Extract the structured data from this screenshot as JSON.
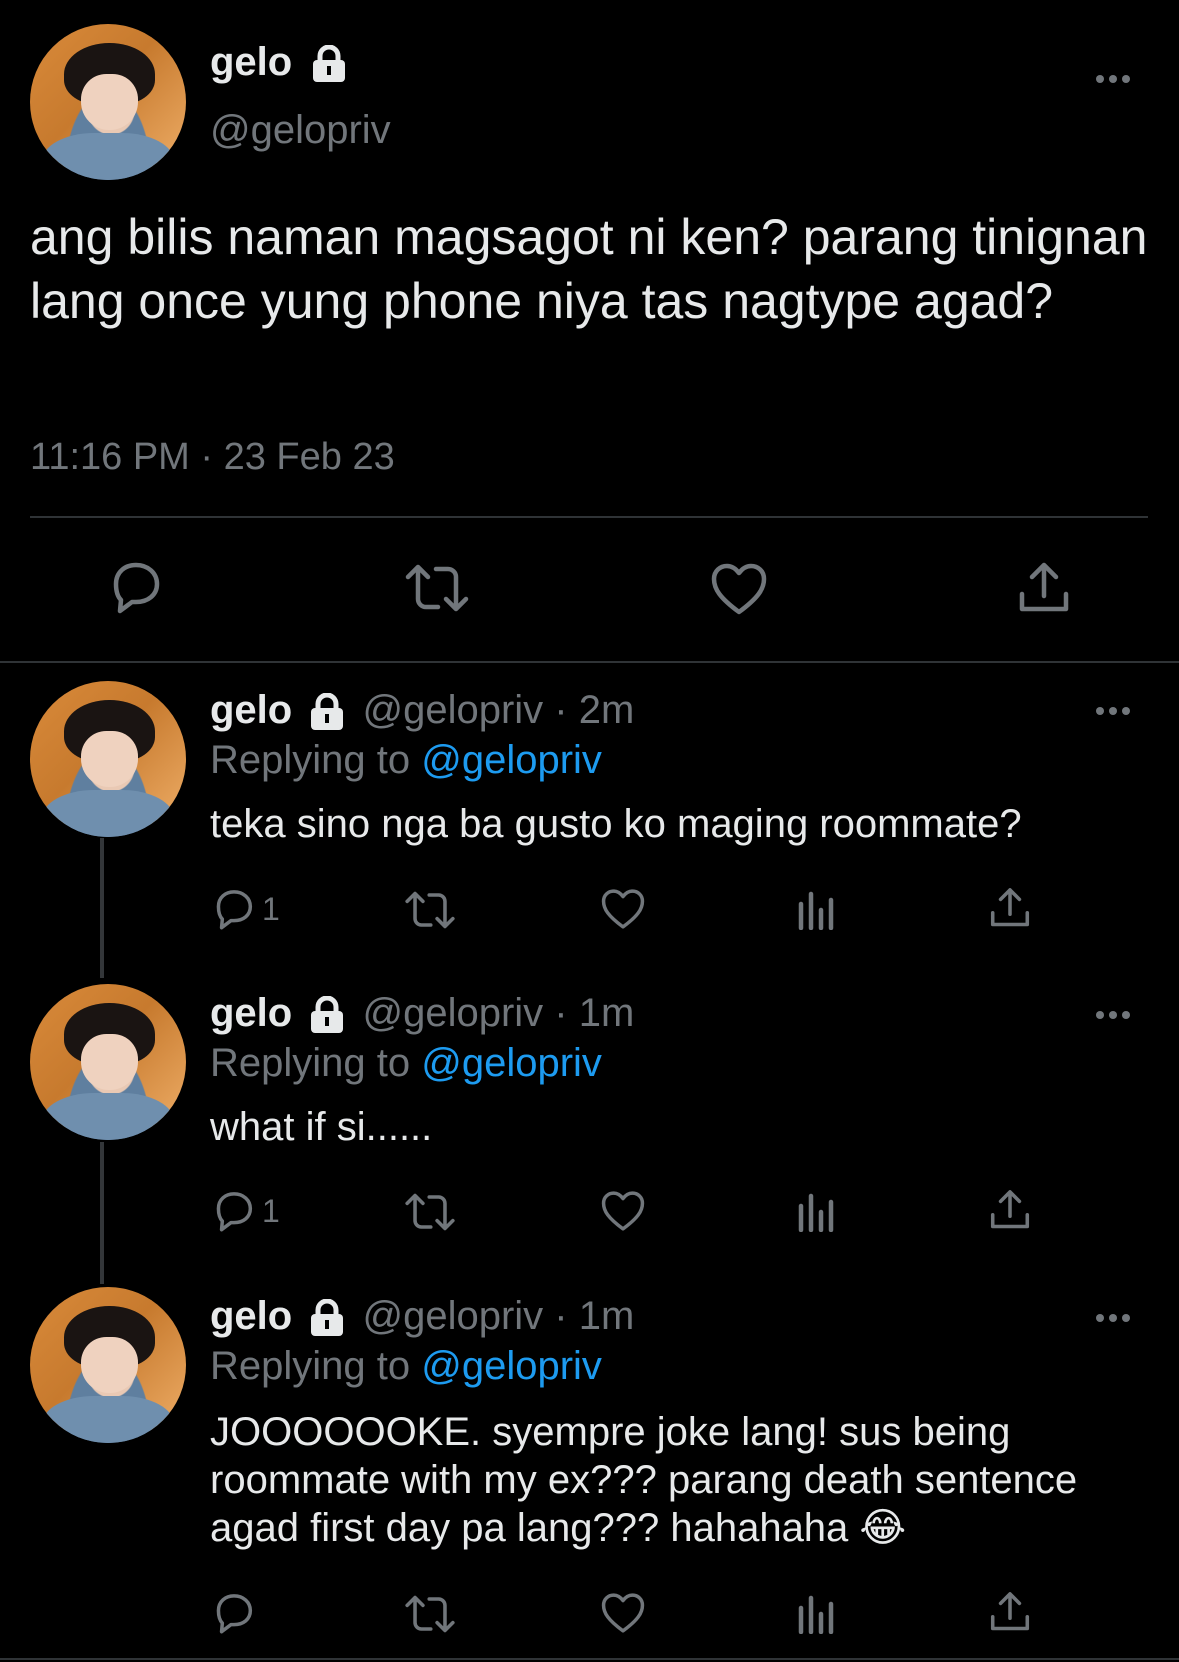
{
  "main_tweet": {
    "display_name": "gelo",
    "handle": "@gelopriv",
    "text": "ang bilis naman magsagot ni ken? parang tinignan lang once yung phone niya tas nagtype agad?",
    "timestamp": "11:16 PM · 23 Feb 23",
    "icons": [
      "reply-icon",
      "retweet-icon",
      "like-icon",
      "share-icon"
    ]
  },
  "replies": [
    {
      "display_name": "gelo",
      "handle": "@gelopriv",
      "time": "· 2m",
      "replying_label": "Replying to",
      "replying_to": "@gelopriv",
      "text": "teka sino nga ba gusto ko maging roommate?",
      "reply_count": "1"
    },
    {
      "display_name": "gelo",
      "handle": "@gelopriv",
      "time": "· 1m",
      "replying_label": "Replying to",
      "replying_to": "@gelopriv",
      "text": "what if si......",
      "reply_count": "1"
    },
    {
      "display_name": "gelo",
      "handle": "@gelopriv",
      "time": "· 1m",
      "replying_label": "Replying to",
      "replying_to": "@gelopriv",
      "text_line1": "JOOOOOOKE. syempre joke lang! sus being",
      "text_line2": "roommate with my ex??? parang death sentence",
      "text_line3": "agad first day pa lang??? hahahaha 😂",
      "reply_count": ""
    }
  ],
  "colors": {
    "background": "#000000",
    "text": "#e7e9ea",
    "secondary": "#71767b",
    "accent": "#1d9bf0",
    "divider": "#2f3336"
  }
}
